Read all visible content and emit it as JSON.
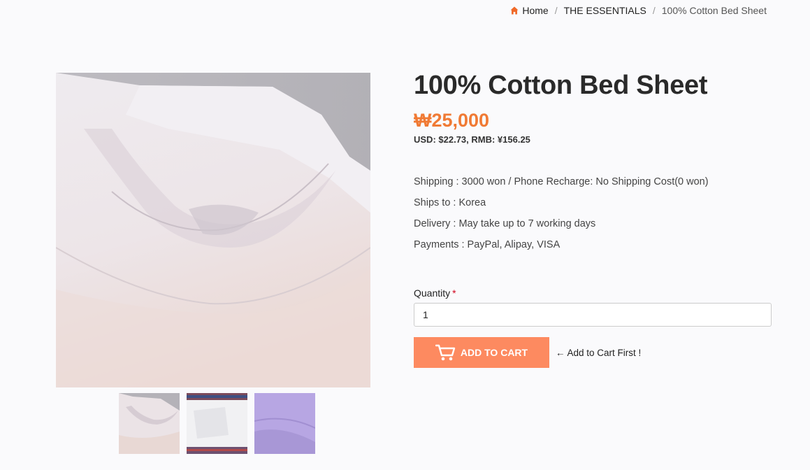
{
  "breadcrumb": {
    "home": "Home",
    "separator": "/",
    "category": "THE ESSENTIALS",
    "current": "100% Cotton Bed Sheet"
  },
  "product": {
    "title": "100% Cotton Bed Sheet",
    "price": "₩25,000",
    "price_alt": "USD: $22.73, RMB: ¥156.25",
    "details": [
      "Shipping : 3000 won / Phone Recharge: No Shipping Cost(0 won)",
      "Ships to : Korea",
      "Delivery : May take up to 7 working days",
      "Payments : PayPal, Alipay, VISA"
    ]
  },
  "quantity": {
    "label": "Quantity",
    "required_mark": "*",
    "value": "1"
  },
  "cart": {
    "button_label": "ADD TO CART",
    "hint": "← Add to Cart First !"
  },
  "colors": {
    "accent": "#f07a34",
    "button": "#fd8a60",
    "home_icon": "#f06a2a"
  },
  "icons": {
    "home": "home-icon",
    "cart": "cart-icon"
  }
}
